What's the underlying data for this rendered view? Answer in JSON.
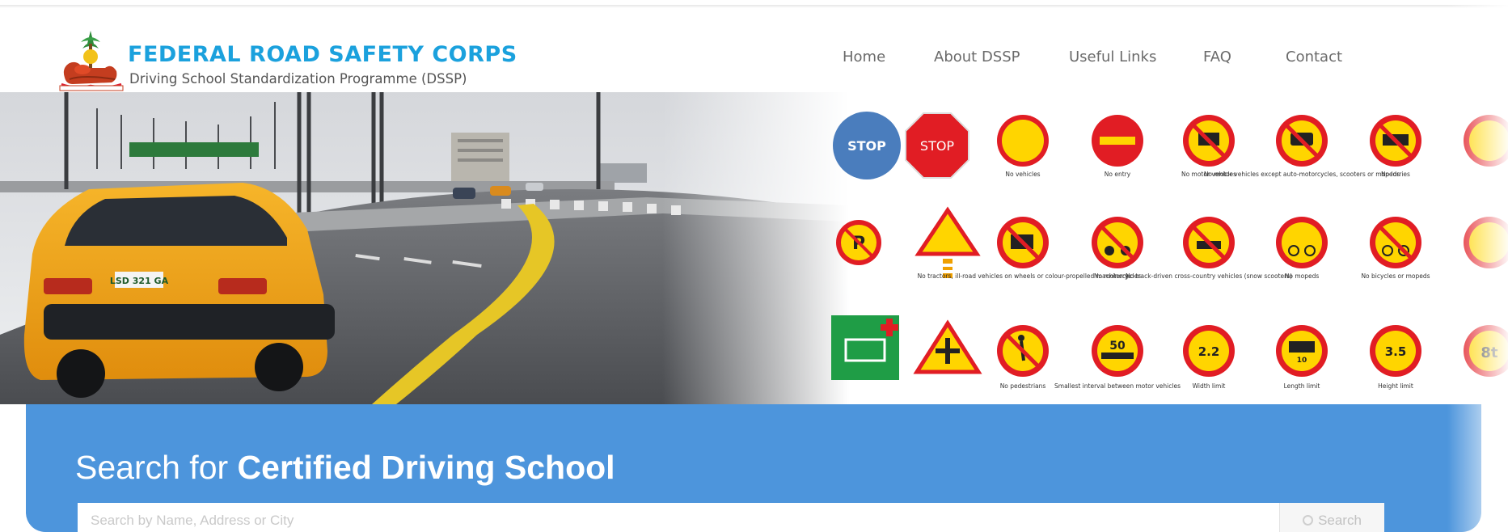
{
  "brand": {
    "title": "FEDERAL ROAD SAFETY CORPS",
    "subtitle": "Driving School Standardization Programme (DSSP)",
    "logo_icon": "frsc-crest-icon"
  },
  "nav": {
    "items": [
      {
        "label": "Home"
      },
      {
        "label": "About DSSP"
      },
      {
        "label": "Useful Links"
      },
      {
        "label": "FAQ"
      },
      {
        "label": "Contact"
      }
    ]
  },
  "hero": {
    "photo": "highway-with-yellow-taxi",
    "car_plate": "LSD 321 GA",
    "signs": {
      "stop_round": "STOP",
      "stop_octagon": "STOP",
      "labels": [
        "No vehicles",
        "No entry",
        "No motor vehicles",
        "No motor vehicles except auto-motorcycles, scooters or mopeds",
        "No lorries",
        "No tractors, ill-road vehicles on wheels or colour-propelled machinery",
        "No motorcycles",
        "No track-driven cross-country vehicles (snow scooters)",
        "No mopeds",
        "No bicycles or mopeds",
        "No pedestrians",
        "Smallest interval between motor vehicles",
        "Width limit",
        "Length limit",
        "Height limit"
      ],
      "values": {
        "interval": "50",
        "width": "2.2",
        "length": "10",
        "height": "3.5",
        "weight": "8t"
      }
    }
  },
  "search": {
    "title_light": "Search for ",
    "title_bold": "Certified Driving School",
    "placeholder": "Search by Name, Address or City",
    "button_label": "Search"
  },
  "colors": {
    "brand_blue": "#1ba1dd",
    "band_blue": "#4d95dc",
    "sign_red": "#e11d24",
    "sign_yellow": "#ffd500"
  }
}
